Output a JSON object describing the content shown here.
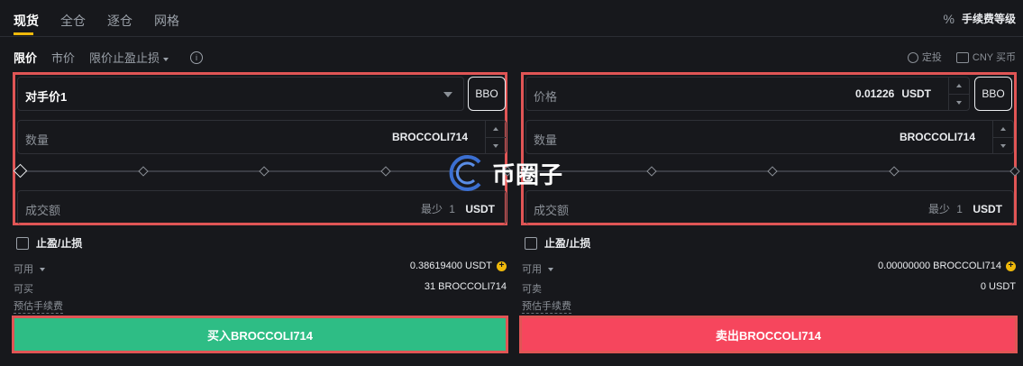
{
  "tabs": [
    {
      "label": "现货",
      "active": true
    },
    {
      "label": "全仓",
      "active": false
    },
    {
      "label": "逐仓",
      "active": false
    },
    {
      "label": "网格",
      "active": false
    }
  ],
  "fee_level": {
    "icon": "percent-icon",
    "label": "手续费等级"
  },
  "order_types": {
    "limit": "限价",
    "market": "市价",
    "tpsl": "限价止盈止损"
  },
  "links": {
    "dca": "定投",
    "buy_cny": "CNY 买币"
  },
  "buy": {
    "price_field": "对手价1",
    "bbo": "BBO",
    "qty_label": "数量",
    "qty_unit": "BROCCOLI714",
    "total_label": "成交额",
    "min_label": "最少",
    "min_value": "1",
    "min_unit": "USDT",
    "tpsl_label": "止盈/止损",
    "available_label": "可用",
    "available_value": "0.38619400 USDT",
    "can_buy_label": "可买",
    "can_buy_value": "31 BROCCOLI714",
    "fee_label": "预估手续费",
    "button": "买入BROCCOLI714"
  },
  "sell": {
    "price_label": "价格",
    "price_value": "0.01226",
    "price_unit": "USDT",
    "bbo": "BBO",
    "qty_label": "数量",
    "qty_unit": "BROCCOLI714",
    "total_label": "成交额",
    "min_label": "最少",
    "min_value": "1",
    "min_unit": "USDT",
    "tpsl_label": "止盈/止损",
    "available_label": "可用",
    "available_value": "0.00000000 BROCCOLI714",
    "can_sell_label": "可卖",
    "can_sell_value": "0 USDT",
    "fee_label": "预估手续费",
    "button": "卖出BROCCOLI714"
  },
  "watermark": "币圈子",
  "colors": {
    "buy": "#2ebd85",
    "sell": "#f6465d",
    "accent": "#f0b90b",
    "highlight": "#e05555"
  }
}
